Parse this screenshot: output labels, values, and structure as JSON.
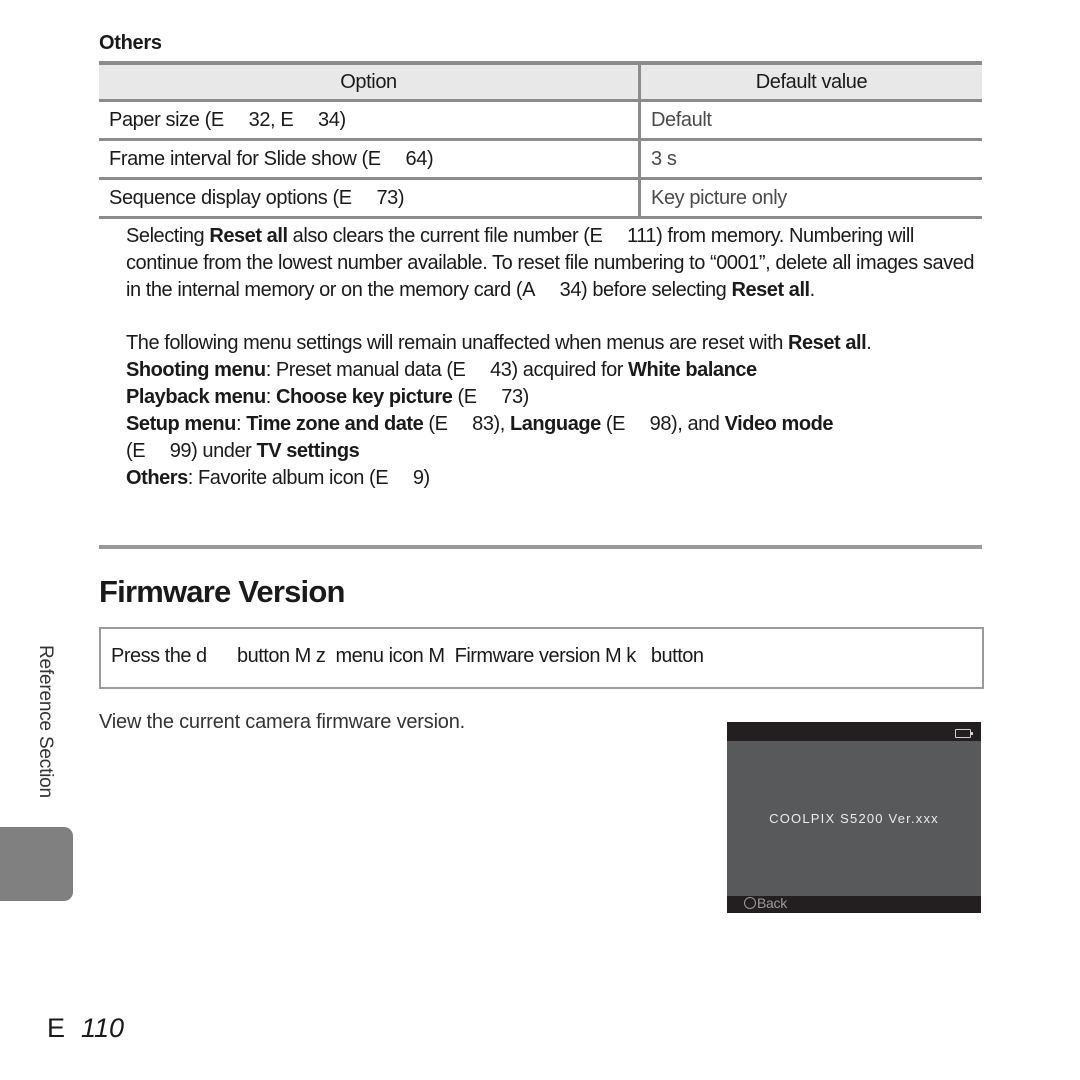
{
  "others_section": {
    "heading": "Others",
    "table": {
      "headers": [
        "Option",
        "Default value"
      ],
      "rows": [
        {
          "option": "Paper size (E  32, E  34)",
          "default": "Default"
        },
        {
          "option": "Frame interval for Slide show (E  64)",
          "default": "3 s"
        },
        {
          "option": "Sequence display options (E  73)",
          "default": "Key picture only"
        }
      ]
    }
  },
  "notes": {
    "note1": {
      "t1": "Selecting ",
      "b1": "Reset all",
      "t2": " also clears the current file number (E  111) from memory. Numbering will continue from the lowest number available. To reset file numbering to “0001”, delete all images saved in the internal memory or on the memory card (A  34) before selecting ",
      "b2": "Reset all",
      "t3": "."
    },
    "note2": {
      "intro": "The following menu settings will remain unaffected when menus are reset with ",
      "intro_bold": "Reset all",
      "intro_end": ".",
      "shooting_label": "Shooting menu",
      "shooting_text": ": Preset manual data (E  43) acquired for ",
      "shooting_bold": "White balance",
      "playback_label": "Playback menu",
      "playback_colon": ": ",
      "playback_bold": "Choose key picture",
      "playback_ref": " (E  73)",
      "setup_label": "Setup menu",
      "setup_colon": ": ",
      "setup_b1": "Time zone and date",
      "setup_t1": " (E  83), ",
      "setup_b2": "Language",
      "setup_t2": " (E  98), and ",
      "setup_b3": "Video mode",
      "setup_t3": "(E  99) under ",
      "setup_b4": "TV settings",
      "others_label": "Others",
      "others_text": ": Favorite album icon (E  9)"
    }
  },
  "firmware_section": {
    "title": "Firmware Version",
    "procedure": "Press the d      button M z  menu icon M  Firmware version M k   button",
    "description": "View the current camera firmware version."
  },
  "camera_screen": {
    "model_text": "COOLPIX S5200 Ver.xxx",
    "back_label": "Back",
    "battery_icon": "battery-full-icon",
    "back_icon": "rotary-back-icon"
  },
  "sidebar": {
    "section_label": "Reference Section"
  },
  "footer": {
    "page_symbol": "E",
    "page_number": "110"
  }
}
